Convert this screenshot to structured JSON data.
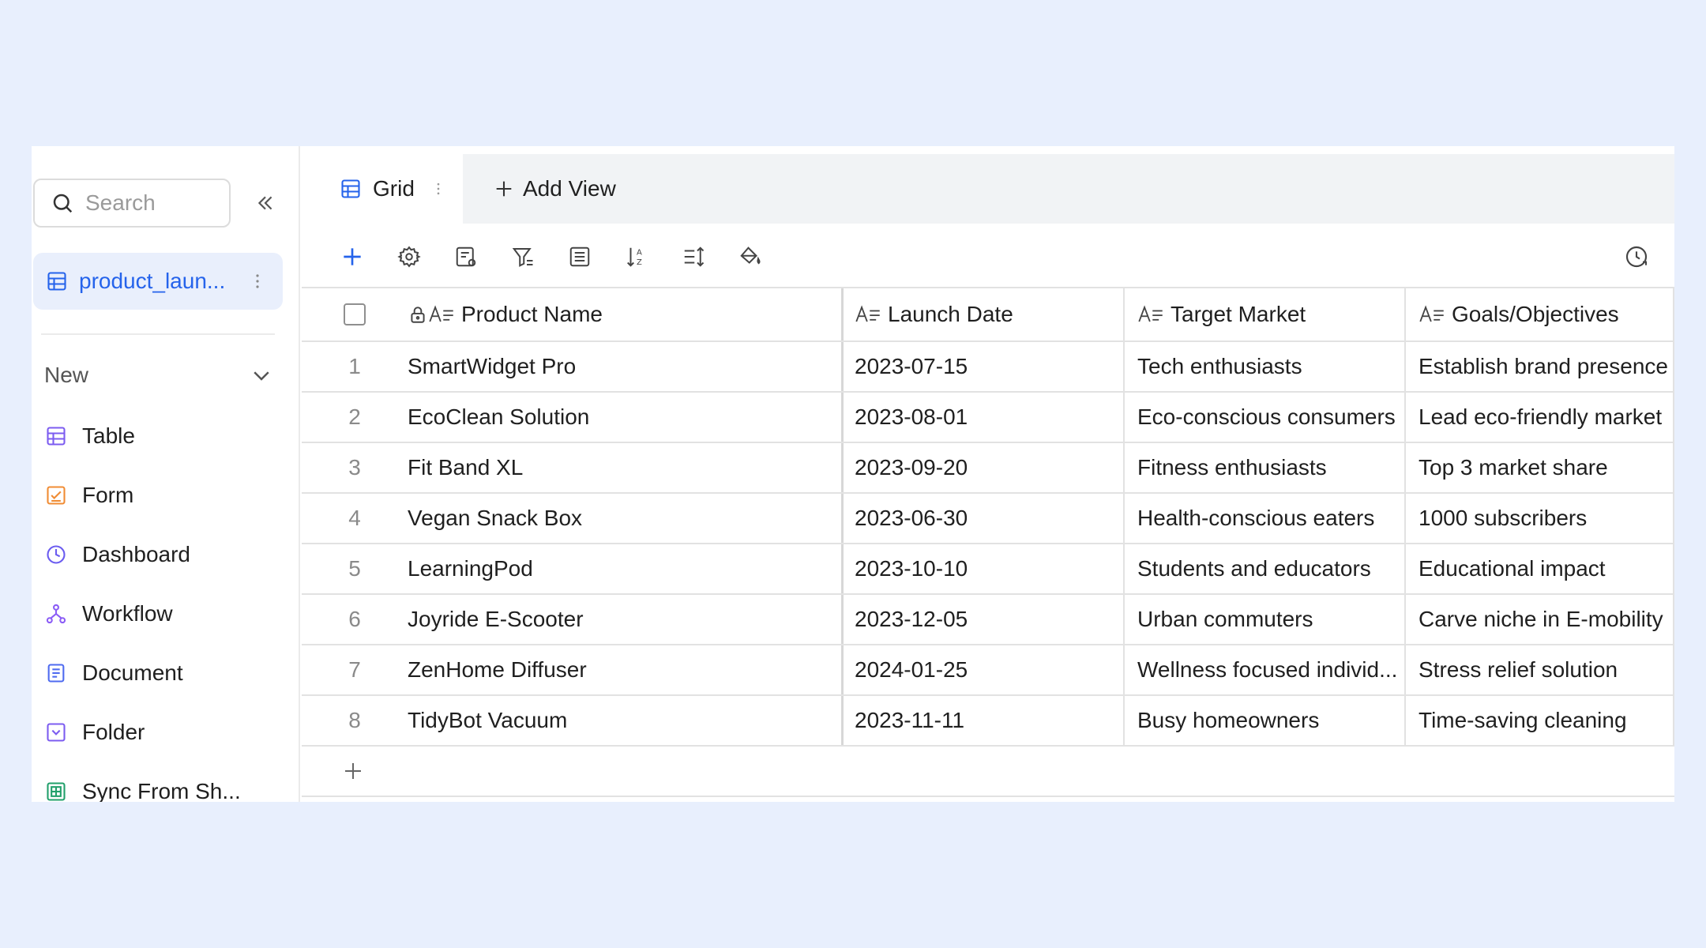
{
  "sidebar": {
    "search_placeholder": "Search",
    "current_doc": "product_laun...",
    "new_label": "New",
    "items": [
      {
        "label": "Table",
        "icon": "table-icon",
        "color": "#7c5cf0"
      },
      {
        "label": "Form",
        "icon": "form-icon",
        "color": "#f08c34"
      },
      {
        "label": "Dashboard",
        "icon": "dashboard-icon",
        "color": "#6b5cf0"
      },
      {
        "label": "Workflow",
        "icon": "workflow-icon",
        "color": "#8b5cf6"
      },
      {
        "label": "Document",
        "icon": "document-icon",
        "color": "#4f6bf0"
      },
      {
        "label": "Folder",
        "icon": "folder-icon",
        "color": "#7c5cf0"
      },
      {
        "label": "Sync From Sh...",
        "icon": "sheet-icon",
        "color": "#22a06b"
      }
    ]
  },
  "tabs": {
    "grid_label": "Grid",
    "add_view_label": "Add View"
  },
  "colors": {
    "accent": "#2563eb",
    "background": "#e8effd"
  },
  "table": {
    "columns": [
      "Product Name",
      "Launch Date",
      "Target Market",
      "Goals/Objectives"
    ],
    "rows": [
      {
        "idx": "1",
        "name": "SmartWidget Pro",
        "date": "2023-07-15",
        "market": "Tech enthusiasts",
        "goals": "Establish brand presence"
      },
      {
        "idx": "2",
        "name": "EcoClean Solution",
        "date": "2023-08-01",
        "market": "Eco-conscious consumers",
        "goals": "Lead eco-friendly market"
      },
      {
        "idx": "3",
        "name": "Fit Band XL",
        "date": "2023-09-20",
        "market": "Fitness enthusiasts",
        "goals": "Top 3 market share"
      },
      {
        "idx": "4",
        "name": "Vegan Snack Box",
        "date": "2023-06-30",
        "market": "Health-conscious eaters",
        "goals": "1000 subscribers"
      },
      {
        "idx": "5",
        "name": "LearningPod",
        "date": "2023-10-10",
        "market": "Students and educators",
        "goals": "Educational impact"
      },
      {
        "idx": "6",
        "name": "Joyride E-Scooter",
        "date": "2023-12-05",
        "market": "Urban commuters",
        "goals": "Carve niche in E-mobility"
      },
      {
        "idx": "7",
        "name": "ZenHome Diffuser",
        "date": "2024-01-25",
        "market": "Wellness focused individ...",
        "goals": "Stress relief solution"
      },
      {
        "idx": "8",
        "name": "TidyBot Vacuum",
        "date": "2023-11-11",
        "market": "Busy homeowners",
        "goals": "Time-saving cleaning"
      }
    ]
  }
}
